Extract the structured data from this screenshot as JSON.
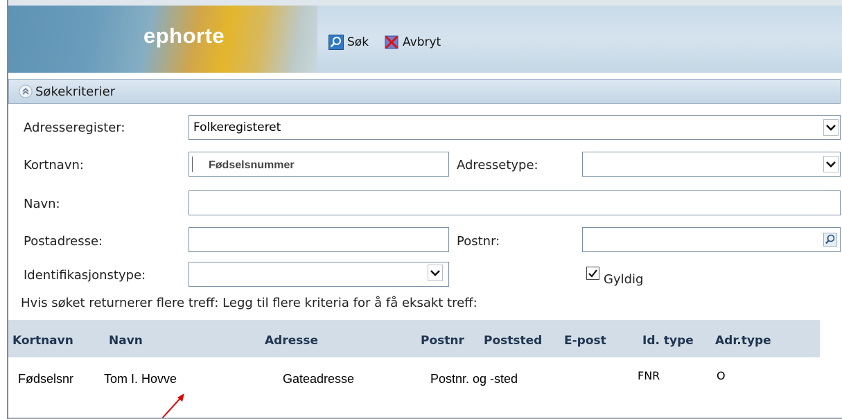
{
  "app": {
    "logo_text": "ephorte"
  },
  "toolbar": {
    "search_label": "Søk",
    "cancel_label": "Avbryt"
  },
  "section": {
    "title": "Søkekriterier"
  },
  "form": {
    "adresseregister": {
      "label": "Adresseregister:",
      "value": "Folkeregisteret"
    },
    "kortnavn": {
      "label": "Kortnavn:",
      "value": "Fødselsnummer"
    },
    "adressetype": {
      "label": "Adressetype:",
      "value": ""
    },
    "navn": {
      "label": "Navn:",
      "value": ""
    },
    "postadresse": {
      "label": "Postadresse:",
      "value": ""
    },
    "postnr": {
      "label": "Postnr:",
      "value": ""
    },
    "identifikasjonstype": {
      "label": "Identifikasjonstype:",
      "value": ""
    },
    "gyldig": {
      "label": "Gyldig",
      "checked": true
    }
  },
  "hint": "Hvis søket returnerer flere treff: Legg til flere kriteria for å få eksakt treff:",
  "table": {
    "headers": [
      "Kortnavn",
      "Navn",
      "Adresse",
      "Postnr",
      "Poststed",
      "E-post",
      "Id. type",
      "Adr.type"
    ],
    "rows": [
      {
        "kortnavn": "Fødselsnr",
        "navn": "Tom I. Hovve",
        "adresse": "Gateadresse",
        "post": "Postnr. og -sted",
        "idtype": "FNR",
        "adrtype": "O"
      }
    ]
  },
  "colors": {
    "header_text": "#1f3550",
    "arrow": "#e00000"
  },
  "icons": [
    "search-icon",
    "cancel-icon",
    "collapse-icon",
    "chevron-down-icon",
    "magnifier-icon",
    "checkmark-icon"
  ]
}
